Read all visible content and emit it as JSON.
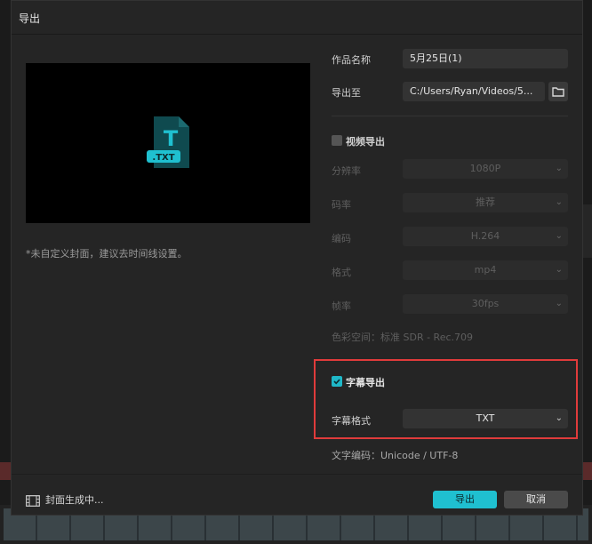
{
  "dialog": {
    "title": "导出"
  },
  "preview": {
    "file_badge": ".TXT",
    "file_letter": "T",
    "cover_note": "*未自定义封面，建议去时间线设置。"
  },
  "form": {
    "name_label": "作品名称",
    "name_value": "5月25日(1)",
    "export_to_label": "导出至",
    "export_to_value": "C:/Users/Ryan/Videos/5...",
    "video_section": {
      "title": "视频导出",
      "checked": false,
      "resolution_label": "分辨率",
      "resolution_value": "1080P",
      "bitrate_label": "码率",
      "bitrate_value": "推荐",
      "codec_label": "编码",
      "codec_value": "H.264",
      "format_label": "格式",
      "format_value": "mp4",
      "framerate_label": "帧率",
      "framerate_value": "30fps",
      "color_space": "色彩空间：标准 SDR - Rec.709"
    },
    "subtitle_section": {
      "title": "字幕导出",
      "checked": true,
      "format_label": "字幕格式",
      "format_value": "TXT",
      "encoding": "文字编码：Unicode / UTF-8"
    }
  },
  "footer": {
    "status": "封面生成中...",
    "export_button": "导出",
    "cancel_button": "取消"
  },
  "colors": {
    "accent": "#1fc0d0",
    "highlight": "#e03b3b"
  }
}
